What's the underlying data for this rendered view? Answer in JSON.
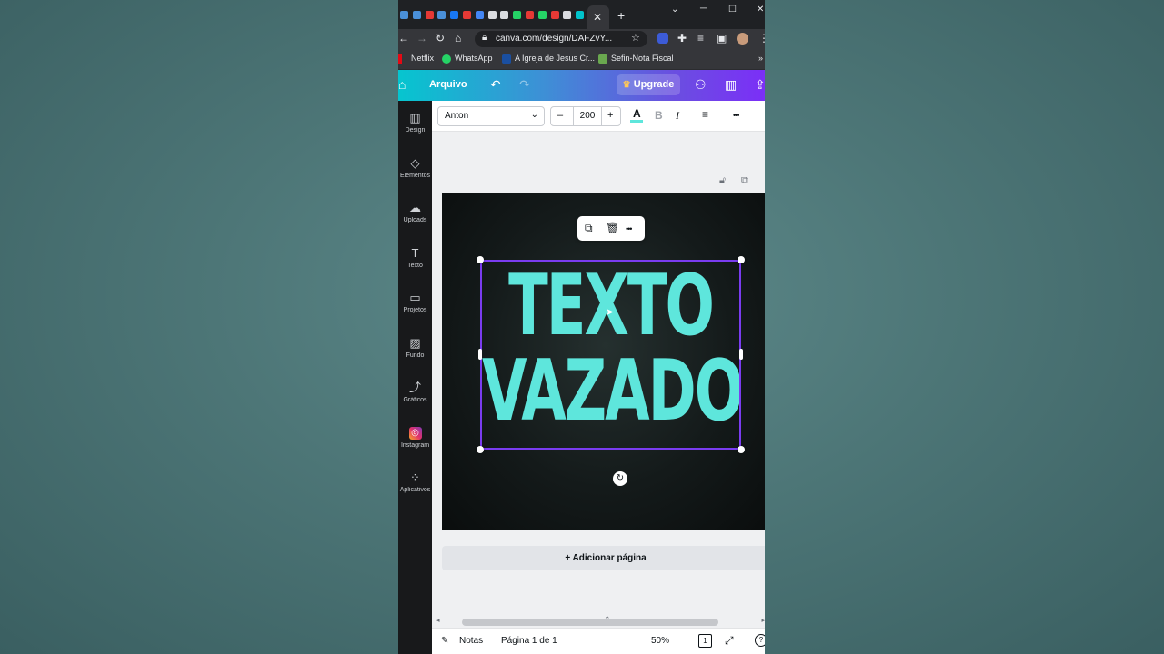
{
  "browser": {
    "tab_close_glyph": "✕",
    "new_tab_glyph": "+",
    "window_controls": [
      "⌄",
      "─",
      "☐",
      "✕"
    ],
    "url": "canva.com/design/DAFZvY...",
    "favicon_colors": [
      "#4a90d9",
      "#4a90d9",
      "#e53935",
      "#4a90d9",
      "#1877f2",
      "#e53935",
      "#4285f4",
      "#dadce0",
      "#dadce0",
      "#25d366",
      "#e53935",
      "#25d366",
      "#e53935",
      "#dadce0",
      "#00c4cc"
    ]
  },
  "bookmarks": [
    {
      "label": "Netflix",
      "icon": "netflix-icon",
      "color": "#e50914"
    },
    {
      "label": "WhatsApp",
      "icon": "whatsapp-icon",
      "color": "#25d366"
    },
    {
      "label": "A Igreja de Jesus Cr...",
      "icon": "church-icon",
      "color": "#1a4fa0"
    },
    {
      "label": "Sefin-Nota Fiscal",
      "icon": "doc-icon",
      "color": "#6aa84f"
    }
  ],
  "header": {
    "menu_label": "Arquivo",
    "upgrade_label": "Upgrade",
    "crown_glyph": "♛"
  },
  "sidebar": {
    "items": [
      {
        "label": "Design",
        "glyph": "▥"
      },
      {
        "label": "Elementos",
        "glyph": "◇"
      },
      {
        "label": "Uploads",
        "glyph": "☁"
      },
      {
        "label": "Texto",
        "glyph": "T"
      },
      {
        "label": "Projetos",
        "glyph": "▭"
      },
      {
        "label": "Fundo",
        "glyph": "▨"
      },
      {
        "label": "Gráficos",
        "glyph": "⤴"
      },
      {
        "label": "Instagram",
        "glyph": "◎"
      },
      {
        "label": "Aplicativos",
        "glyph": "⁘"
      }
    ]
  },
  "text_toolbar": {
    "font": "Anton",
    "size": "200",
    "minus": "–",
    "plus": "+",
    "color_glyph": "A",
    "bold_glyph": "B",
    "italic_glyph": "I",
    "align_glyph": "≡",
    "more_glyph": "•••"
  },
  "canvas": {
    "line1": "TEXTO",
    "line2": "VAZADO",
    "text_color": "#5ee6dc",
    "selection_color": "#7a3cf0",
    "rotate_glyph": "↻"
  },
  "floating_menu": {
    "more_glyph": "•••"
  },
  "add_page_label": "+ Adicionar página",
  "footer": {
    "notes_label": "Notas",
    "page_label": "Página 1 de 1",
    "zoom": "50%",
    "page_count_badge": "1",
    "help_glyph": "?"
  }
}
